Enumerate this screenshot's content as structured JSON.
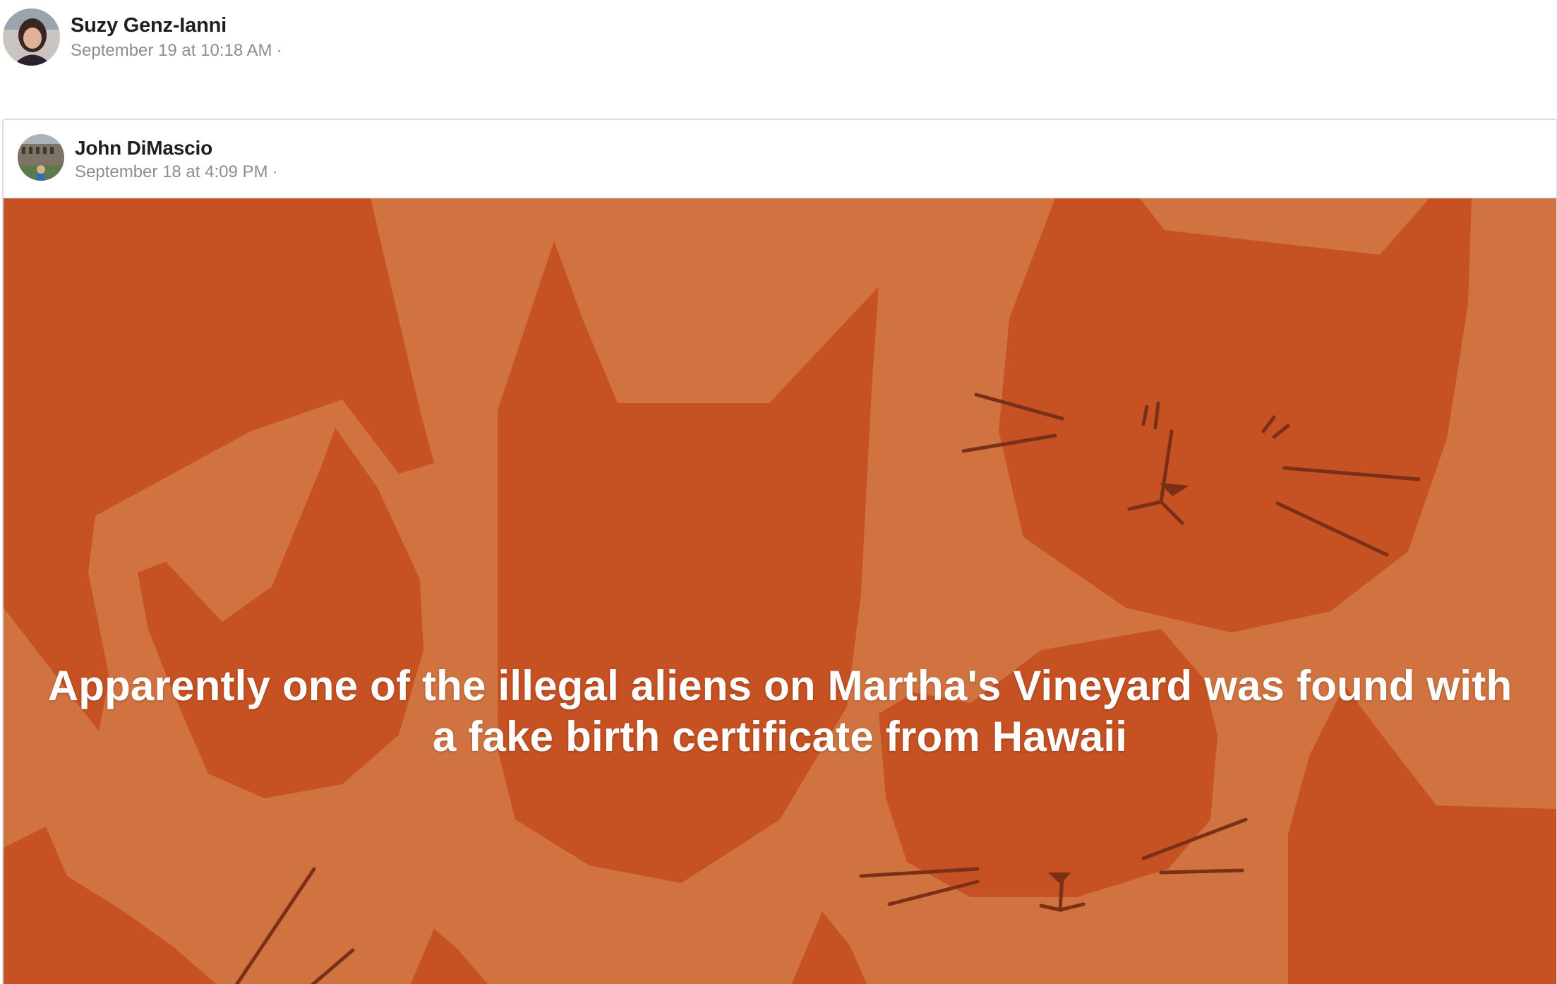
{
  "outer_post": {
    "author": "Suzy Genz-Ianni",
    "timestamp": "September 19 at 10:18 AM",
    "separator": "·",
    "avatar_icon": "profile-photo-woman"
  },
  "shared_post": {
    "author": "John DiMascio",
    "timestamp": "September 18 at 4:09 PM",
    "separator": "·",
    "avatar_icon": "profile-photo-building",
    "image": {
      "background": "orange cats pattern",
      "colors": {
        "background": "#d07340",
        "cat_shape": "#c65122",
        "whisker": "#7a2f17",
        "text": "#ffffff"
      },
      "caption": "Apparently one of the illegal aliens on Martha's Vineyard was found with a fake birth certificate from Hawaii"
    }
  }
}
